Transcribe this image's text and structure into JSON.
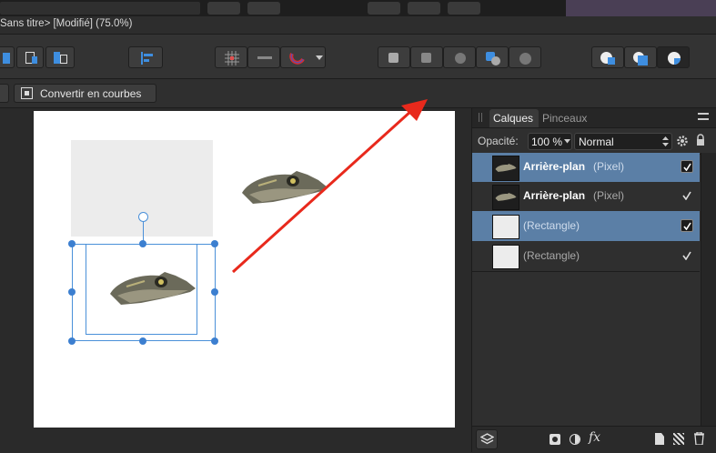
{
  "window": {
    "title": "Sans titre> [Modifié] (75.0%)"
  },
  "context_toolbar": {
    "convert_label": "Convertir en courbes"
  },
  "panel": {
    "tabs": [
      {
        "label": "Calques"
      },
      {
        "label": "Pinceaux"
      }
    ],
    "opacity_label": "Opacité:",
    "opacity_value": "100 %",
    "blend_mode": "Normal",
    "layers": [
      {
        "name": "Arrière-plan",
        "type": "(Pixel)",
        "selected": true,
        "visible": true,
        "thumb": "lizard"
      },
      {
        "name": "Arrière-plan",
        "type": "(Pixel)",
        "selected": false,
        "visible": true,
        "thumb": "lizard"
      },
      {
        "name": "",
        "type": "(Rectangle)",
        "selected": true,
        "visible": true,
        "thumb": "rect"
      },
      {
        "name": "",
        "type": "(Rectangle)",
        "selected": false,
        "visible": true,
        "thumb": "rect"
      }
    ],
    "footer_fx": "fx"
  },
  "colors": {
    "accent": "#4a90d9",
    "layer_selected": "#5b7fa6",
    "annotation_arrow": "#e8291c"
  }
}
